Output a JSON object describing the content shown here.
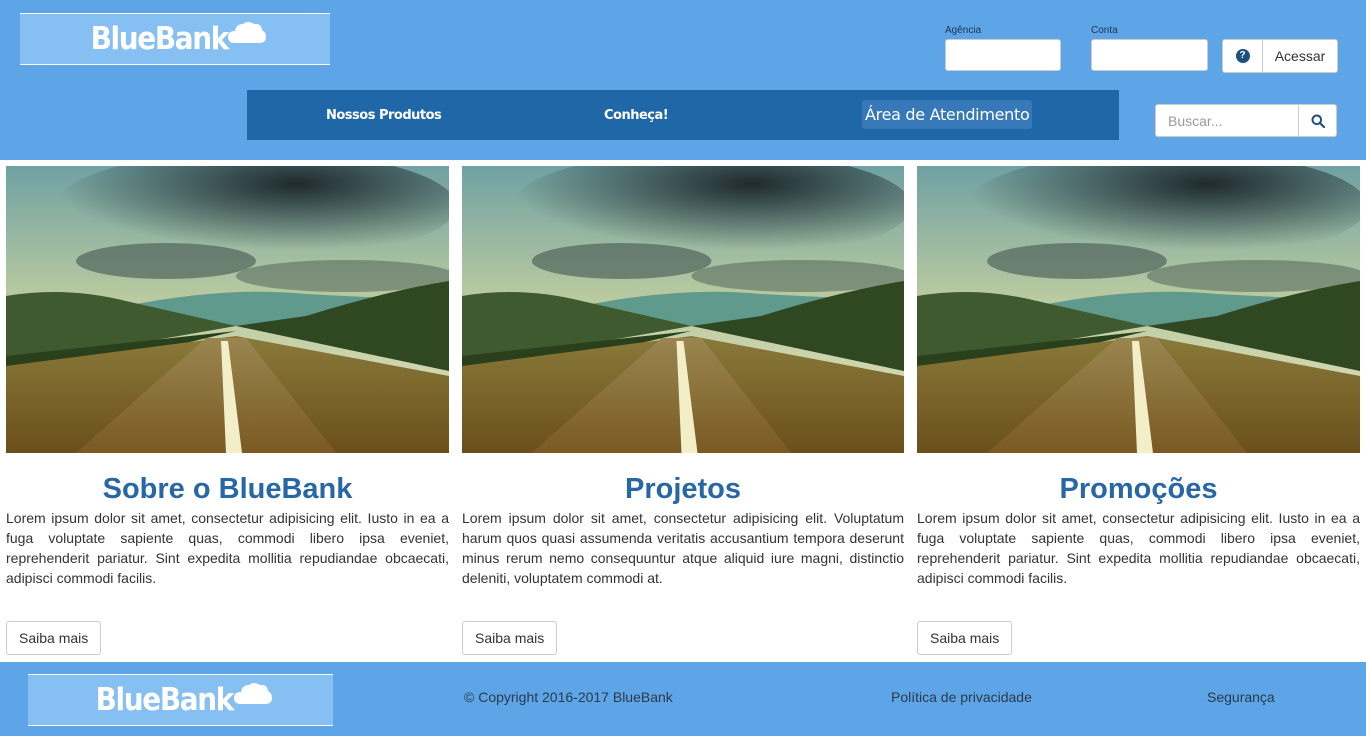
{
  "brand": {
    "name": "BlueBank"
  },
  "login": {
    "agencia_label": "Agência",
    "conta_label": "Conta",
    "agencia_value": "",
    "conta_value": "",
    "help_symbol": "?",
    "submit_label": "Acessar"
  },
  "nav": {
    "items": [
      {
        "label": "Nossos Produtos"
      },
      {
        "label": "Conheça!"
      },
      {
        "label": "Área de Atendimento"
      }
    ]
  },
  "search": {
    "placeholder": "Buscar..."
  },
  "cards": [
    {
      "title": "Sobre o BlueBank",
      "text": "Lorem ipsum dolor sit amet, consectetur adipisicing elit. Iusto in ea a fuga voluptate sapiente quas, commodi libero ipsa eveniet, reprehenderit pariatur. Sint expedita mollitia repudiandae obcaecati, adipisci commodi facilis.",
      "button": "Saiba mais"
    },
    {
      "title": "Projetos",
      "text": "Lorem ipsum dolor sit amet, consectetur adipisicing elit. Voluptatum harum quos quasi assumenda veritatis accusantium tempora deserunt minus rerum nemo consequuntur atque aliquid iure magni, distinctio deleniti, voluptatem commodi at.",
      "button": "Saiba mais"
    },
    {
      "title": "Promoções",
      "text": "Lorem ipsum dolor sit amet, consectetur adipisicing elit. Iusto in ea a fuga voluptate sapiente quas, commodi libero ipsa eveniet, reprehenderit pariatur. Sint expedita mollitia repudiandae obcaecati, adipisci commodi facilis.",
      "button": "Saiba mais"
    }
  ],
  "footer": {
    "copyright": "© Copyright 2016-2017 BlueBank",
    "privacy": "Política de privacidade",
    "security": "Segurança"
  },
  "icons": {
    "help": "question-circle-icon",
    "search": "magnifier-icon",
    "logo_cloud": "cloud-icon",
    "card_image": "road-landscape-image"
  },
  "colors": {
    "header_bg": "#5da5e6",
    "logo_bg": "#86c0f3",
    "nav_bg": "#2067a8",
    "nav_active_bg": "#3778b8",
    "title_blue": "#2867a6"
  }
}
